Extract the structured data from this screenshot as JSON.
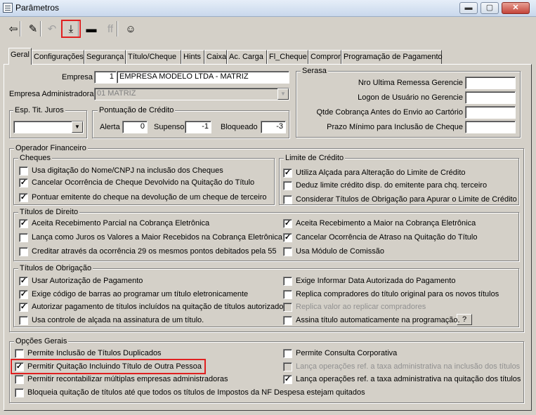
{
  "window": {
    "title": "Parâmetros",
    "minimize": "▬",
    "maximize": "▢",
    "close": "✕"
  },
  "toolbar": {
    "buttons": [
      {
        "icon": "exit-icon",
        "glyph": "⇦"
      },
      {
        "icon": "clear-icon",
        "glyph": "✎"
      },
      {
        "icon": "undo-icon",
        "glyph": "↶",
        "disabled": true
      },
      {
        "icon": "save-icon",
        "glyph": "⤓",
        "selected": true
      },
      {
        "icon": "cancel-icon",
        "glyph": "▬"
      },
      {
        "icon": "find-icon",
        "glyph": "ff",
        "disabled": true
      },
      {
        "icon": "user-icon",
        "glyph": "☺"
      }
    ]
  },
  "tabs": [
    "Geral",
    "Configurações",
    "Segurança",
    "Título/Cheque",
    "Hints",
    "Caixa",
    "Ac. Carga",
    "Fl_Cheque",
    "Compror",
    "Programação de Pagamento"
  ],
  "empresa": {
    "label": "Empresa",
    "code": "1",
    "name": "EMPRESA MODELO LTDA - MATRIZ"
  },
  "empresa_adm": {
    "label": "Empresa Administradora",
    "value": "01 MATRIZ"
  },
  "esp_tit_juros": {
    "label": "Esp. Tit. Juros",
    "value": ""
  },
  "pontuacao": {
    "label": "Pontuação de Crédito",
    "alerta_label": "Alerta",
    "alerta": "0",
    "supenso_label": "Supenso",
    "supenso": "-1",
    "bloqueado_label": "Bloqueado",
    "bloqueado": "-3"
  },
  "serasa": {
    "label": "Serasa",
    "fields": [
      {
        "label": "Nro Ultima Remessa Gerencie",
        "value": ""
      },
      {
        "label": "Logon de Usuário no Gerencie",
        "value": ""
      },
      {
        "label": "Qtde Cobrança  Antes do Envio ao Cartório",
        "value": ""
      },
      {
        "label": "Prazo Mínimo para Inclusão de Cheque",
        "value": ""
      }
    ]
  },
  "operador": {
    "label": "Operador Financeiro",
    "cheques": {
      "label": "Cheques",
      "items": [
        {
          "text": "Usa digitação do Nome/CNPJ na inclusão dos Cheques",
          "checked": false
        },
        {
          "text": "Cancelar Ocorrência de Cheque Devolvido na Quitação do Título",
          "checked": true
        },
        {
          "text": "Pontuar emitente do cheque na devolução de um cheque de terceiro",
          "checked": true
        }
      ]
    },
    "limite": {
      "label": "Limite de Crédito",
      "items": [
        {
          "text": "Utiliza Alçada para Alteração do Limite de Crédito",
          "checked": true
        },
        {
          "text": "Deduz limite crédito disp. do emitente para chq. terceiro",
          "checked": false
        },
        {
          "text": "Considerar Títulos de Obrigação para Apurar o Limite de Crédito",
          "checked": false
        }
      ]
    },
    "direito": {
      "label": "Títulos de Direito",
      "left": [
        {
          "text": "Aceita Recebimento Parcial na Cobrança Eletrônica",
          "checked": true
        },
        {
          "text": "Lança como Juros os Valores a Maior Recebidos na Cobrança Eletrônica",
          "checked": false
        },
        {
          "text": "Creditar através da ocorrência 29 os mesmos pontos debitados pela 55",
          "checked": false
        }
      ],
      "right": [
        {
          "text": "Aceita Recebimento a Maior na Cobrança Eletrônica",
          "checked": true
        },
        {
          "text": "Cancelar Ocorrência de Atraso na Quitação do Título",
          "checked": true
        },
        {
          "text": "Usa Módulo de Comissão",
          "checked": false
        }
      ]
    },
    "obrigacao": {
      "label": "Títulos de Obrigação",
      "left": [
        {
          "text": "Usar Autorização de Pagamento",
          "checked": true
        },
        {
          "text": "Exige código de barras ao programar um título eletronicamente",
          "checked": true
        },
        {
          "text": "Autorizar pagamento de títulos incluídos na quitação de títulos autorizados",
          "checked": true
        },
        {
          "text": "Usa controle de alçada na assinatura de um título.",
          "checked": false
        }
      ],
      "right": [
        {
          "text": "Exige Informar Data Autorizada do Pagamento",
          "checked": false
        },
        {
          "text": "Replica compradores do título original para os novos títulos",
          "checked": false
        },
        {
          "text": "Replica valor ao replicar compradores",
          "checked": false,
          "disabled": true
        },
        {
          "text": "Assina título automaticamente na programação.",
          "checked": false
        }
      ],
      "help_button": "?"
    }
  },
  "opcoes": {
    "label": "Opções Gerais",
    "left": [
      {
        "text": "Permite Inclusão de Títulos Duplicados",
        "checked": false
      },
      {
        "text": "Permitir Quitação Incluindo Título de Outra Pessoa",
        "checked": true,
        "highlighted": true
      },
      {
        "text": "Permitir recontabilizar múltiplas empresas administradoras",
        "checked": false
      },
      {
        "text": "Bloqueia quitação de títulos até que todos os títulos de Impostos da NF Despesa estejam quitados",
        "checked": false
      }
    ],
    "right": [
      {
        "text": "Permite Consulta Corporativa",
        "checked": false
      },
      {
        "text": "Lança operações ref. a taxa administrativa na inclusão dos títulos",
        "checked": false,
        "disabled": true
      },
      {
        "text": "Lança operações ref. a taxa administrativa na quitação dos títulos",
        "checked": true
      }
    ]
  },
  "colors": {
    "highlight": "#e02020",
    "face": "#d4d0c8"
  }
}
